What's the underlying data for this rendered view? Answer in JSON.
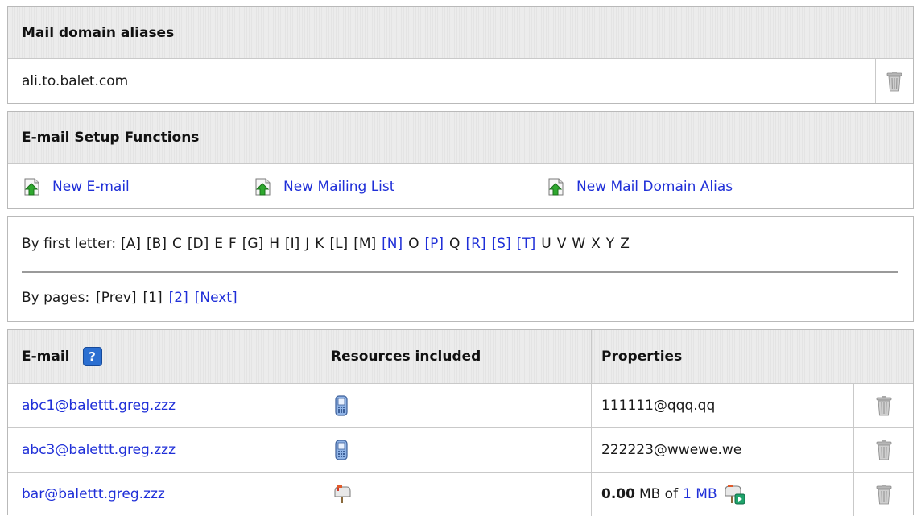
{
  "aliases_panel": {
    "title": "Mail domain aliases",
    "alias": "ali.to.balet.com"
  },
  "setup_panel": {
    "title": "E-mail Setup Functions",
    "new_email": "New E-mail",
    "new_mailing_list": "New Mailing List",
    "new_alias": "New Mail Domain Alias"
  },
  "filter_panel": {
    "by_letter_label": "By first letter:",
    "letters": [
      {
        "t": "[A]",
        "link": false
      },
      {
        "t": "[B]",
        "link": false
      },
      {
        "t": "C",
        "link": false
      },
      {
        "t": "[D]",
        "link": false
      },
      {
        "t": "E",
        "link": false
      },
      {
        "t": "F",
        "link": false
      },
      {
        "t": "[G]",
        "link": false
      },
      {
        "t": "H",
        "link": false
      },
      {
        "t": "[I]",
        "link": false
      },
      {
        "t": "J",
        "link": false
      },
      {
        "t": "K",
        "link": false
      },
      {
        "t": "[L]",
        "link": false
      },
      {
        "t": "[M]",
        "link": false
      },
      {
        "t": "[N]",
        "link": true
      },
      {
        "t": "O",
        "link": false
      },
      {
        "t": "[P]",
        "link": true
      },
      {
        "t": "Q",
        "link": false
      },
      {
        "t": "[R]",
        "link": true
      },
      {
        "t": "[S]",
        "link": true
      },
      {
        "t": "[T]",
        "link": true
      },
      {
        "t": "U",
        "link": false
      },
      {
        "t": "V",
        "link": false
      },
      {
        "t": "W",
        "link": false
      },
      {
        "t": "X",
        "link": false
      },
      {
        "t": "Y",
        "link": false
      },
      {
        "t": "Z",
        "link": false
      }
    ],
    "by_pages_label": "By pages:",
    "prev": "[Prev]",
    "page1": "[1]",
    "page2": "[2]",
    "next": "[Next]"
  },
  "table": {
    "col_email": "E-mail",
    "help_glyph": "?",
    "col_resources": "Resources included",
    "col_properties": "Properties",
    "rows": [
      {
        "email": "abc1@balettt.greg.zzz",
        "resource_icon": "mobile-phone-icon",
        "prop": "111111@qqq.qq"
      },
      {
        "email": "abc3@balettt.greg.zzz",
        "resource_icon": "mobile-phone-icon",
        "prop": "222223@wwewe.we"
      },
      {
        "email": "bar@balettt.greg.zzz",
        "resource_icon": "mailbox-icon",
        "prop_used": "0.00",
        "prop_unit": "MB of",
        "prop_quota": "1 MB"
      }
    ]
  },
  "colors": {
    "link": "#1f2fd8",
    "header_bg": "#e9e9e9",
    "border": "#b9b9b9"
  }
}
